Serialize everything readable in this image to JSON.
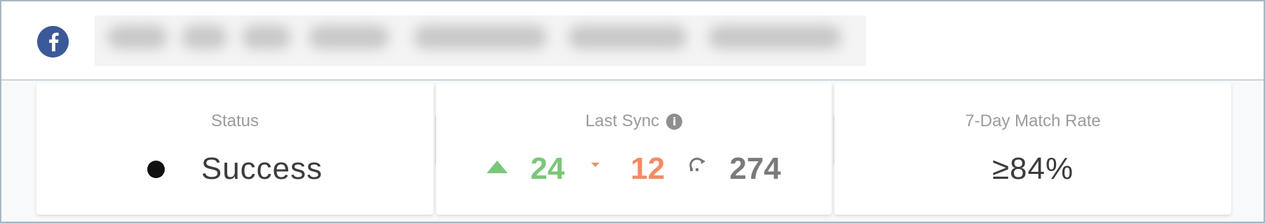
{
  "header": {
    "platform_icon": "facebook-icon",
    "platform_color": "#3b5998",
    "name_redacted": true
  },
  "cards": {
    "status": {
      "label": "Status",
      "value": "Success",
      "dot_color": "#111111"
    },
    "last_sync": {
      "label": "Last Sync",
      "info_icon": "info-icon",
      "info_glyph": "i",
      "added": "24",
      "removed": "12",
      "total": "274",
      "added_icon": "triangle-up-icon",
      "removed_icon": "triangle-down-icon",
      "total_icon": "refresh-icon",
      "added_color": "#7cc67a",
      "removed_color": "#f28b63",
      "total_color": "#7a7a7a"
    },
    "match_rate": {
      "label": "7-Day Match Rate",
      "value": "≥84%"
    }
  }
}
